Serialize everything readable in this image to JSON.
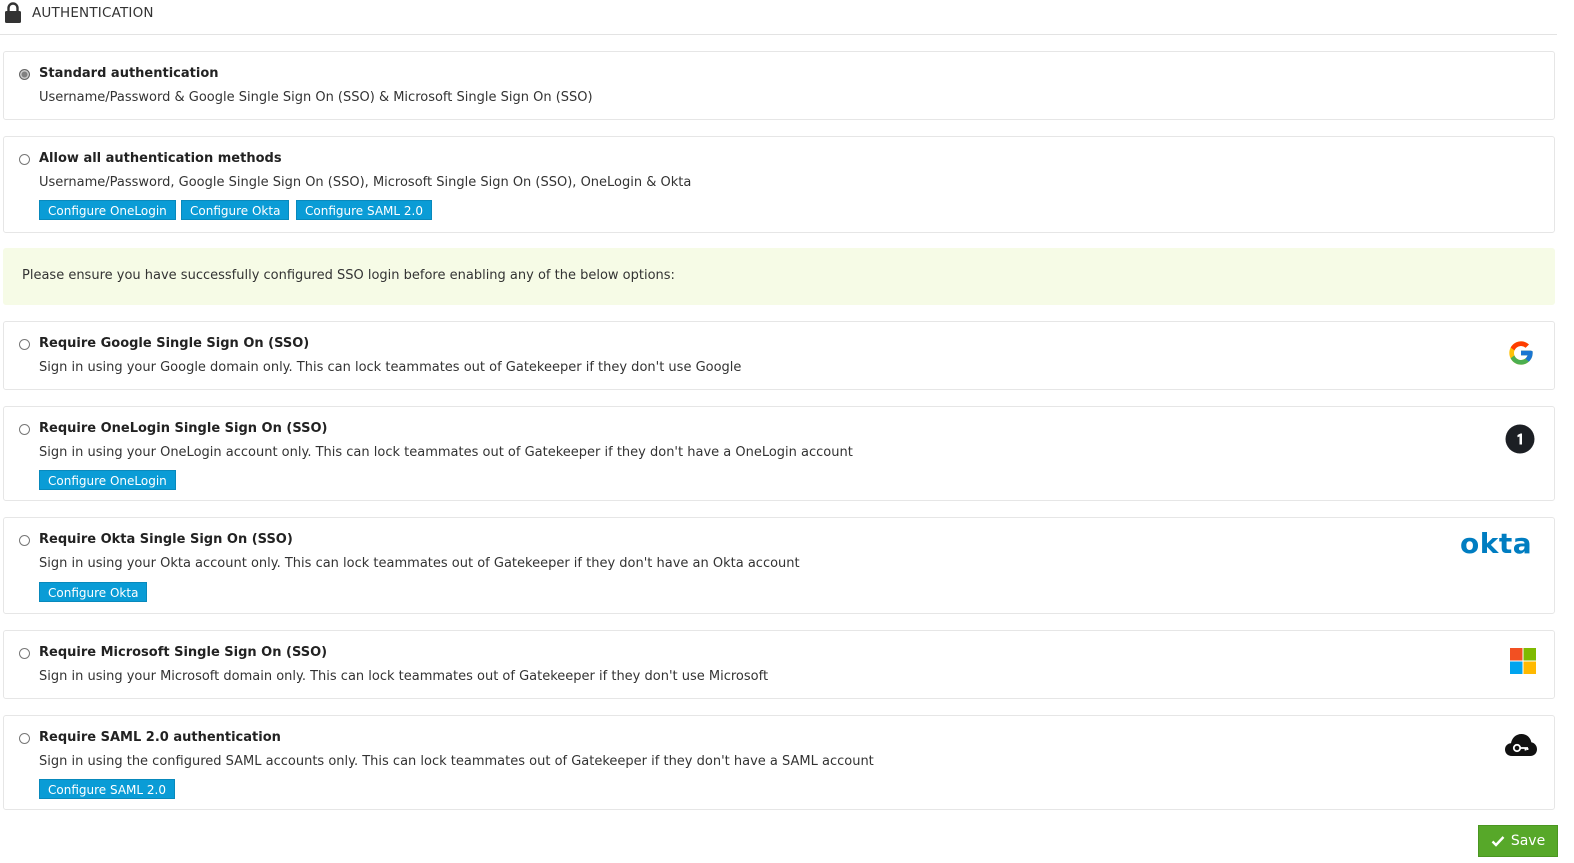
{
  "header": {
    "title": "AUTHENTICATION",
    "icon": "lock-icon"
  },
  "options": [
    {
      "title": "Standard authentication",
      "description": "Username/Password & Google Single Sign On (SSO) & Microsoft Single Sign On (SSO)",
      "selected": true
    },
    {
      "title": "Allow all authentication methods",
      "description": "Username/Password, Google Single Sign On (SSO), Microsoft Single Sign On (SSO), OneLogin & Okta",
      "buttons": [
        "Configure OneLogin",
        "Configure Okta",
        "Configure SAML 2.0"
      ]
    }
  ],
  "notice": "Please ensure you have successfully configured SSO login before enabling any of the below options:",
  "require_options": [
    {
      "title": "Require Google Single Sign On (SSO)",
      "description": "Sign in using your Google domain only. This can lock teammates out of Gatekeeper if they don't use Google",
      "logo": "google-logo"
    },
    {
      "title": "Require OneLogin Single Sign On (SSO)",
      "description": "Sign in using your OneLogin account only. This can lock teammates out of Gatekeeper if they don't have a OneLogin account",
      "button": "Configure OneLogin",
      "logo": "onelogin-logo"
    },
    {
      "title": "Require Okta Single Sign On (SSO)",
      "description": "Sign in using your Okta account only. This can lock teammates out of Gatekeeper if they don't have an Okta account",
      "button": "Configure Okta",
      "logo": "okta-logo",
      "logo_text": "okta"
    },
    {
      "title": "Require Microsoft Single Sign On (SSO)",
      "description": "Sign in using your Microsoft domain only. This can lock teammates out of Gatekeeper if they don't use Microsoft",
      "logo": "microsoft-logo"
    },
    {
      "title": "Require SAML 2.0 authentication",
      "description": "Sign in using the configured SAML accounts only. This can lock teammates out of Gatekeeper if they don't have a SAML account",
      "button": "Configure SAML 2.0",
      "logo": "cloud-key-icon"
    }
  ],
  "save_label": "Save",
  "colors": {
    "button": "#0a9cd6",
    "save": "#57a829",
    "notice_bg": "#f6fbe6",
    "okta": "#007dc1"
  }
}
